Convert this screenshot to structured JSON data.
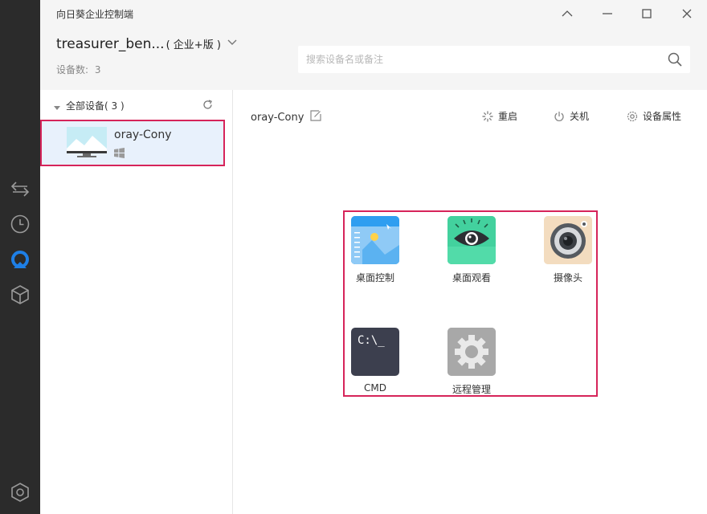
{
  "window": {
    "title": "向日葵企业控制端"
  },
  "account": {
    "name": "treasurer_ben...",
    "edition": "( 企业+版 )",
    "device_count_label": "设备数:",
    "device_count": "3"
  },
  "search": {
    "placeholder": "搜索设备名或备注"
  },
  "group": {
    "label": "全部设备( 3 )"
  },
  "devices": [
    {
      "name": "oray-Cony",
      "os": "windows-icon"
    }
  ],
  "detail": {
    "device_name": "oray-Cony",
    "actions": {
      "restart": "重启",
      "shutdown": "关机",
      "properties": "设备属性"
    }
  },
  "apps": [
    {
      "label": "桌面控制",
      "icon": "desktop-control-icon"
    },
    {
      "label": "桌面观看",
      "icon": "desktop-view-icon"
    },
    {
      "label": "摄像头",
      "icon": "camera-icon"
    },
    {
      "label": "CMD",
      "icon": "cmd-icon",
      "tile_text": "C:\\_"
    },
    {
      "label": "远程管理",
      "icon": "remote-manage-icon"
    }
  ],
  "sidebar": {
    "icons": [
      "transfer-icon",
      "history-icon",
      "sunlogin-icon",
      "cube-icon",
      "settings-hex-icon"
    ]
  },
  "colors": {
    "highlight_border": "#d6245a",
    "selected_bg": "#e8f1fc",
    "sidebar_bg": "#2b2b2b",
    "accent_blue": "#1e7fe6"
  }
}
